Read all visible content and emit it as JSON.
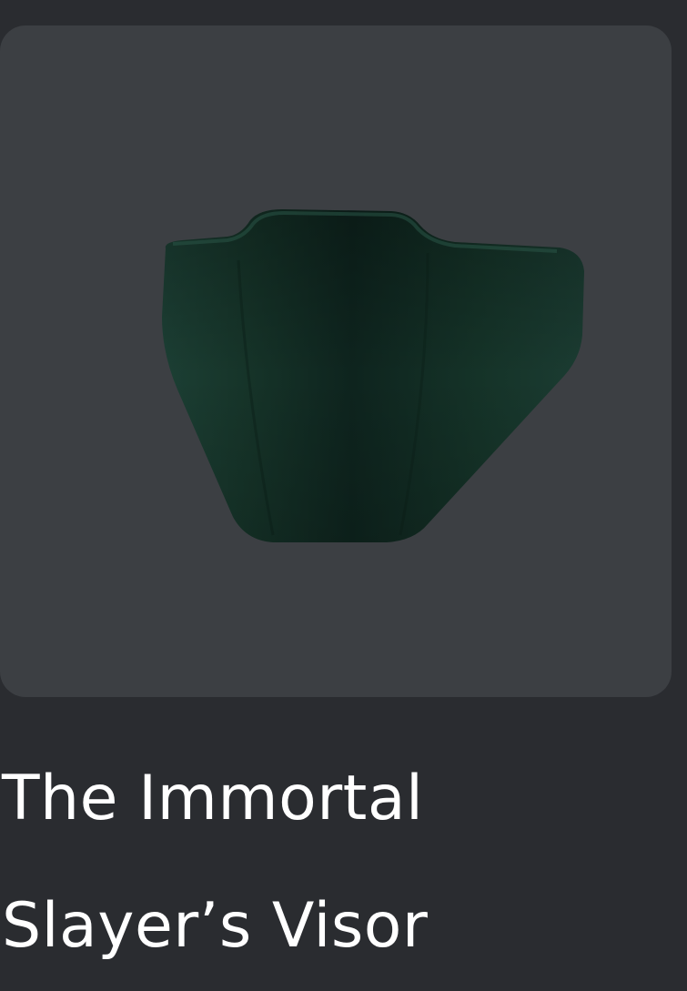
{
  "item": {
    "name_line1": "The Immortal",
    "name_line2": "Slayer’s Visor",
    "thumbnail_icon": "visor-item-icon",
    "colors": {
      "page_background": "#2a2c30",
      "thumbnail_background": "#3c3f43",
      "visor_main": "#143129",
      "visor_dark": "#0c1f1a",
      "visor_highlight": "#1e4438",
      "text": "#ffffff"
    }
  }
}
